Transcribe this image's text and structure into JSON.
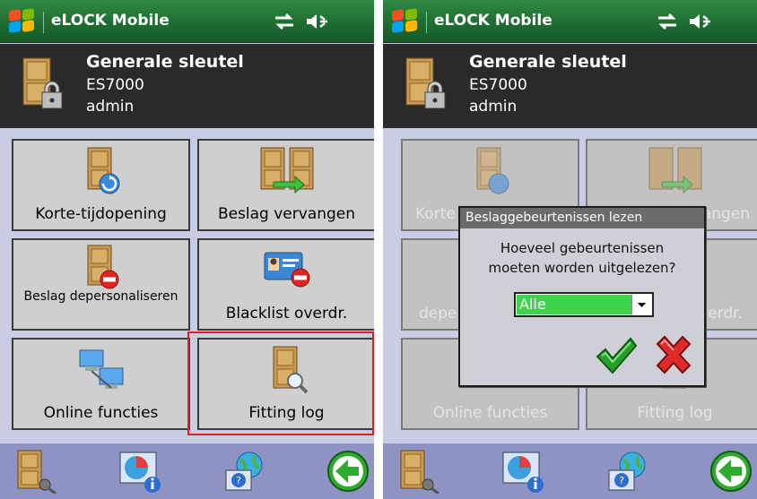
{
  "left": {
    "title_bar": {
      "app_title": "eLOCK Mobile"
    },
    "header": {
      "title": "Generale sleutel",
      "model": "ES7000",
      "user": "admin"
    },
    "tiles": [
      {
        "label": "Korte-tijdopening",
        "icon": "door-clock-icon"
      },
      {
        "label": "Beslag vervangen",
        "icon": "door-replace-icon"
      },
      {
        "label": "Beslag depersonaliseren",
        "icon": "door-remove-icon"
      },
      {
        "label": "Blacklist overdr.",
        "icon": "card-remove-icon"
      },
      {
        "label": "Online functies",
        "icon": "network-icon"
      },
      {
        "label": "Fitting log",
        "icon": "door-search-icon"
      }
    ]
  },
  "right": {
    "title_bar": {
      "app_title": "eLOCK Mobile"
    },
    "header": {
      "title": "Generale sleutel",
      "model": "ES7000",
      "user": "admin"
    },
    "tiles": [
      {
        "label": "Korte"
      },
      {
        "label": "vangen"
      },
      {
        "label": "depe"
      },
      {
        "label": "verdr."
      },
      {
        "label": "Online functies"
      },
      {
        "label": "Fitting log"
      }
    ],
    "dialog": {
      "title": "Beslaggebeurtenissen lezen",
      "message_line1": "Hoeveel gebeurtenissen",
      "message_line2": "moeten worden uitgelezen?",
      "select_value": "Alle"
    }
  },
  "colors": {
    "title_bar": "#1f6d32",
    "header": "#2a2a2a",
    "body": "#c9cde4",
    "tile": "#cfcfcf",
    "bottom_bar": "#8e93c4",
    "highlight": "#e02020",
    "select_fill": "#3dd34a"
  }
}
